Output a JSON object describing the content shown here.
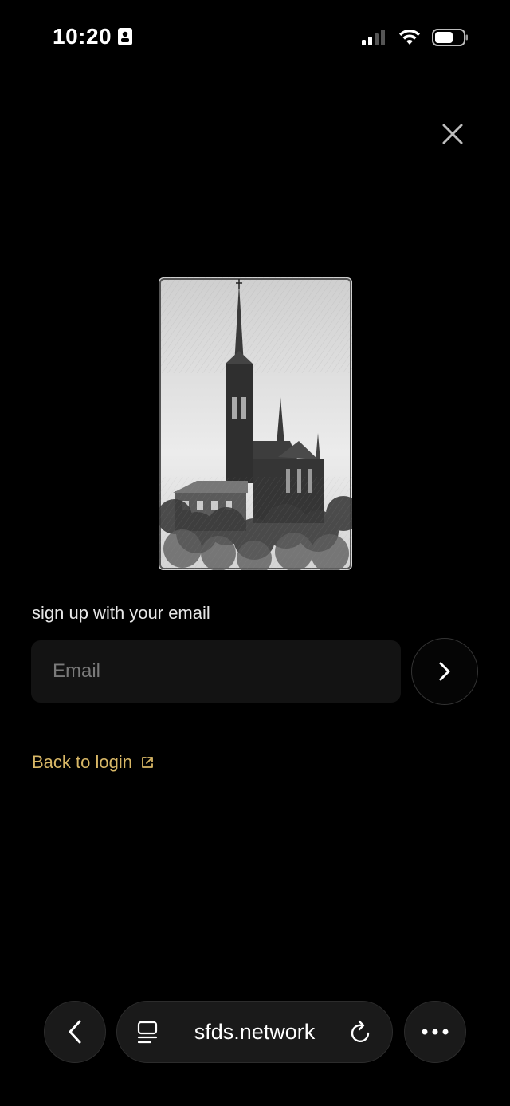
{
  "status_bar": {
    "time": "10:20",
    "icons": [
      "id-card-icon",
      "signal-icon",
      "wifi-icon",
      "battery-icon"
    ]
  },
  "close": {
    "icon": "close-icon"
  },
  "hero": {
    "icon": "gothic-cathedral-sketch-image"
  },
  "signup": {
    "label": "sign up with your email",
    "email_placeholder": "Email",
    "email_value": "",
    "submit_icon": "chevron-right-icon"
  },
  "back_link": {
    "label": "Back to login",
    "icon": "external-link-icon",
    "color": "#d8b766"
  },
  "browser_bar": {
    "url": "sfds.network",
    "back_icon": "chevron-left-icon",
    "reader_icon": "reader-icon",
    "reload_icon": "reload-icon",
    "more_icon": "more-icon"
  }
}
